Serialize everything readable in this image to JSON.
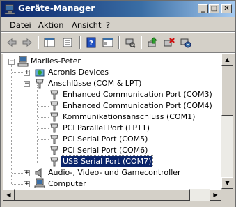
{
  "window": {
    "title": "Geräte-Manager"
  },
  "titlebar_buttons": {
    "minimize": "_",
    "maximize": "□",
    "close": "✕"
  },
  "menu": [
    {
      "label": "Datei",
      "accel": "D"
    },
    {
      "label": "Aktion",
      "accel": "k"
    },
    {
      "label": "Ansicht",
      "accel": "n"
    },
    {
      "label": "?",
      "accel": "?"
    }
  ],
  "toolbar": {
    "icons": [
      "back-icon",
      "forward-icon",
      "properties-pane-icon",
      "refresh-icon",
      "help-icon",
      "view-icon",
      "scan-hardware-icon",
      "update-driver-icon",
      "uninstall-icon",
      "disable-icon"
    ]
  },
  "tree": {
    "root": "Marlies-Peter",
    "items": [
      {
        "label": "Acronis Devices",
        "expander": "+"
      },
      {
        "label": "Anschlüsse (COM & LPT)",
        "expander": "−"
      },
      {
        "label": "Enhanced Communication Port (COM3)"
      },
      {
        "label": "Enhanced Communication Port (COM4)"
      },
      {
        "label": "Kommunikationsanschluss (COM1)"
      },
      {
        "label": "PCI Parallel Port (LPT1)"
      },
      {
        "label": "PCI Serial Port (COM5)"
      },
      {
        "label": "PCI Serial Port (COM6)"
      },
      {
        "label": "USB Serial Port (COM7)",
        "selected": true
      },
      {
        "label": "Audio-, Video- und Gamecontroller",
        "expander": "+"
      },
      {
        "label": "Computer",
        "expander": "+"
      }
    ]
  },
  "colors": {
    "selection": "#0a246a",
    "titlebar": "#0a246a"
  }
}
